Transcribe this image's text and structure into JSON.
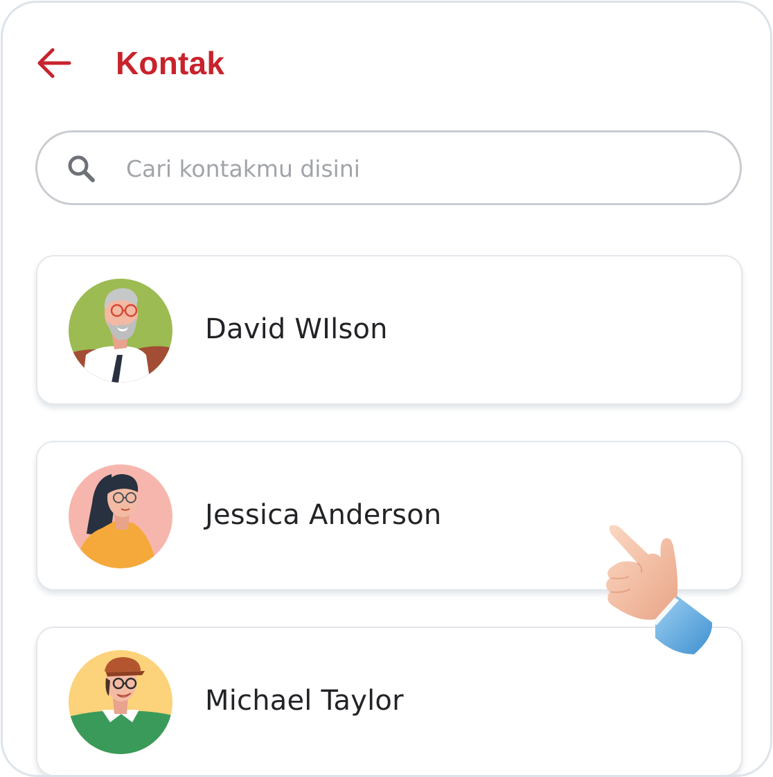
{
  "header": {
    "title": "Kontak",
    "back_icon": "arrow-left-icon"
  },
  "search": {
    "placeholder": "Cari kontakmu disini",
    "value": "",
    "icon": "search-icon"
  },
  "contacts": [
    {
      "name": "David WIlson"
    },
    {
      "name": "Jessica Anderson"
    },
    {
      "name": "Michael Taylor"
    }
  ],
  "colors": {
    "accent": "#c8232c",
    "text": "#222326",
    "placeholder": "#a1a4a8",
    "border": "#c9ccd1"
  }
}
